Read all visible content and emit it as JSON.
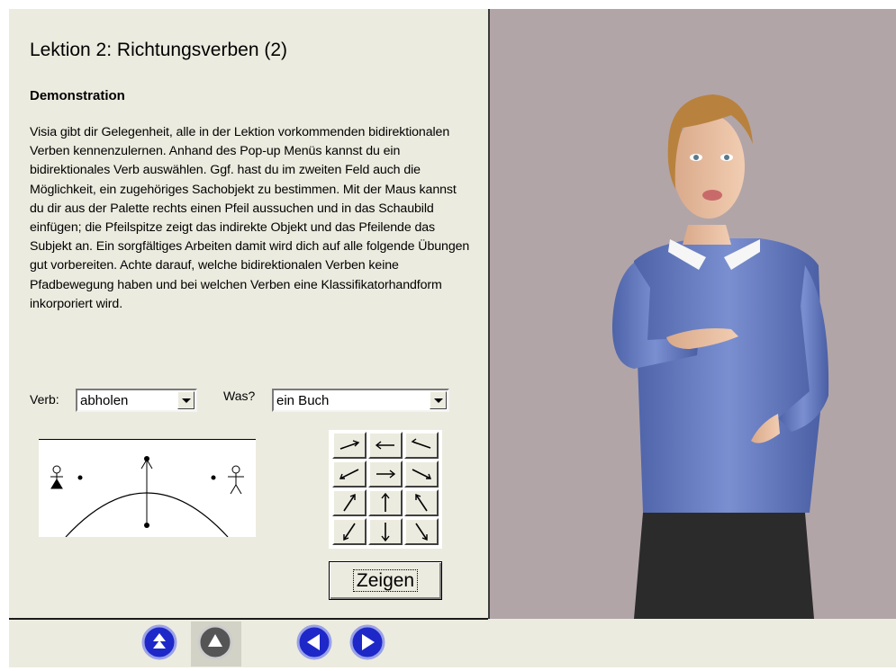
{
  "lesson": {
    "title": "Lektion 2:  Richtungsverben  (2)",
    "subtitle": "Demonstration",
    "description": "Visia gibt dir Gelegenheit, alle in der Lektion vorkommenden bidirektionalen Verben kennenzulernen. Anhand des Pop-up Menüs kannst du ein bidirektionales Verb auswählen. Ggf. hast du im zweiten Feld auch die Möglichkeit, ein zugehöriges Sachobjekt zu bestimmen. Mit der Maus kannst du dir aus der Palette rechts einen Pfeil aussuchen und in das Schaubild einfügen; die Pfeilspitze zeigt das indirekte Objekt und das Pfeilende das Subjekt an. Ein sorgfältiges Arbeiten damit wird dich auf alle folgende Übungen gut vorbereiten. Achte darauf, welche bidirektionalen Verben keine Pfadbewegung haben und bei welchen Verben eine Klassifikatorhandform inkorporiert wird."
  },
  "controls": {
    "verb_label": "Verb:",
    "verb_value": "abholen",
    "was_label": "Was?",
    "was_value": "ein Buch",
    "show_button": "Zeigen"
  },
  "palette": {
    "arrows": [
      "arrow-right-up-shallow",
      "arrow-left",
      "arrow-right-down-shallow",
      "arrow-left-down-shallow",
      "arrow-right",
      "arrow-left-up-shallow",
      "arrow-up-right",
      "arrow-up",
      "arrow-up-left",
      "arrow-down-left",
      "arrow-down",
      "arrow-down-right"
    ]
  },
  "navigation": {
    "icons": [
      "eject-icon",
      "triangle-up-icon",
      "prev-arrow-icon",
      "next-arrow-icon"
    ]
  },
  "colors": {
    "panel_bg": "#ecebdf",
    "video_bg": "#b2a5a8",
    "nav_blue": "#1e28c8"
  }
}
